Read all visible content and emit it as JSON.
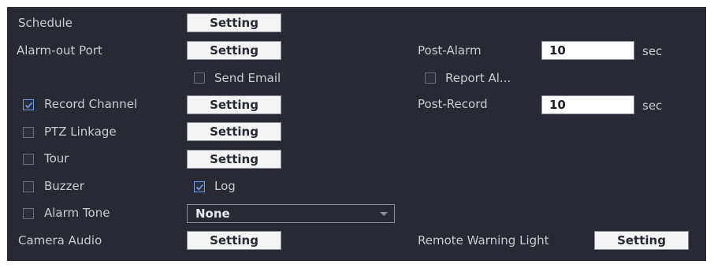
{
  "rows": {
    "schedule": {
      "label": "Schedule",
      "button": "Setting"
    },
    "alarm_out": {
      "label": "Alarm-out Port",
      "button": "Setting"
    },
    "post_alarm": {
      "label": "Post-Alarm",
      "value": "10",
      "unit": "sec"
    },
    "send_email": {
      "label": "Send Email",
      "checked": false
    },
    "report_alarm": {
      "label": "Report Al...",
      "checked": false
    },
    "record_channel": {
      "label": "Record Channel",
      "checked": true,
      "button": "Setting"
    },
    "post_record": {
      "label": "Post-Record",
      "value": "10",
      "unit": "sec"
    },
    "ptz_linkage": {
      "label": "PTZ Linkage",
      "checked": false,
      "button": "Setting"
    },
    "tour": {
      "label": "Tour",
      "checked": false,
      "button": "Setting"
    },
    "buzzer": {
      "label": "Buzzer",
      "checked": false
    },
    "log": {
      "label": "Log",
      "checked": true
    },
    "alarm_tone": {
      "label": "Alarm Tone",
      "checked": false,
      "selected": "None"
    },
    "camera_audio": {
      "label": "Camera Audio",
      "button": "Setting"
    },
    "remote_warning_light": {
      "label": "Remote Warning Light",
      "button": "Setting"
    }
  },
  "colors": {
    "panel_bg": "#272a33",
    "label_text": "#c9ccd3",
    "button_bg": "#f4f4f5",
    "check_accent": "#6b9df5"
  },
  "icons": {
    "checkmark": "checkmark-icon",
    "dropdown": "chevron-down-icon"
  }
}
